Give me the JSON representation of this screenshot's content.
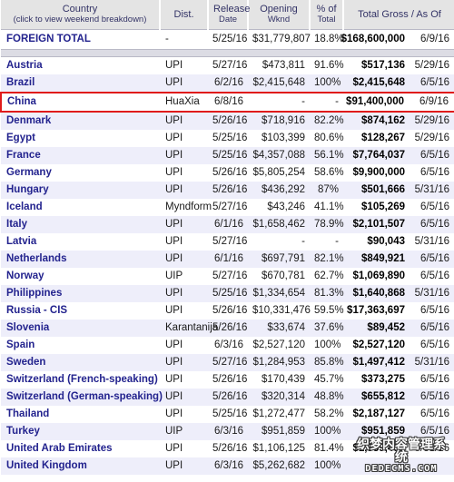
{
  "table": {
    "columns": [
      {
        "key": "country",
        "label": "Country",
        "sub": "(click to view weekend breakdown)"
      },
      {
        "key": "dist",
        "label": "Dist.",
        "sub": ""
      },
      {
        "key": "release",
        "label": "Release",
        "sub": "Date"
      },
      {
        "key": "opening",
        "label": "Opening",
        "sub": "Wknd"
      },
      {
        "key": "pct",
        "label": "% of",
        "sub": "Total"
      },
      {
        "key": "gross",
        "label": "Total Gross / As Of",
        "sub": ""
      }
    ],
    "total_row": {
      "country": "FOREIGN TOTAL",
      "dist": "-",
      "release": "5/25/16",
      "opening": "$31,779,807",
      "pct": "18.8%",
      "gross": "$168,600,000",
      "asof": "6/9/16"
    },
    "rows": [
      {
        "country": "Austria",
        "dist": "UPI",
        "release": "5/27/16",
        "opening": "$473,811",
        "pct": "91.6%",
        "gross": "$517,136",
        "asof": "5/29/16",
        "highlight": false
      },
      {
        "country": "Brazil",
        "dist": "UPI",
        "release": "6/2/16",
        "opening": "$2,415,648",
        "pct": "100%",
        "gross": "$2,415,648",
        "asof": "6/5/16",
        "highlight": false
      },
      {
        "country": "China",
        "dist": "HuaXia",
        "release": "6/8/16",
        "opening": "-",
        "pct": "-",
        "gross": "$91,400,000",
        "asof": "6/9/16",
        "highlight": true
      },
      {
        "country": "Denmark",
        "dist": "UPI",
        "release": "5/26/16",
        "opening": "$718,916",
        "pct": "82.2%",
        "gross": "$874,162",
        "asof": "5/29/16",
        "highlight": false
      },
      {
        "country": "Egypt",
        "dist": "UPI",
        "release": "5/25/16",
        "opening": "$103,399",
        "pct": "80.6%",
        "gross": "$128,267",
        "asof": "5/29/16",
        "highlight": false
      },
      {
        "country": "France",
        "dist": "UPI",
        "release": "5/25/16",
        "opening": "$4,357,088",
        "pct": "56.1%",
        "gross": "$7,764,037",
        "asof": "6/5/16",
        "highlight": false
      },
      {
        "country": "Germany",
        "dist": "UPI",
        "release": "5/26/16",
        "opening": "$5,805,254",
        "pct": "58.6%",
        "gross": "$9,900,000",
        "asof": "6/5/16",
        "highlight": false
      },
      {
        "country": "Hungary",
        "dist": "UPI",
        "release": "5/26/16",
        "opening": "$436,292",
        "pct": "87%",
        "gross": "$501,666",
        "asof": "5/31/16",
        "highlight": false
      },
      {
        "country": "Iceland",
        "dist": "Myndform",
        "release": "5/27/16",
        "opening": "$43,246",
        "pct": "41.1%",
        "gross": "$105,269",
        "asof": "6/5/16",
        "highlight": false
      },
      {
        "country": "Italy",
        "dist": "UPI",
        "release": "6/1/16",
        "opening": "$1,658,462",
        "pct": "78.9%",
        "gross": "$2,101,507",
        "asof": "6/5/16",
        "highlight": false
      },
      {
        "country": "Latvia",
        "dist": "UPI",
        "release": "5/27/16",
        "opening": "-",
        "pct": "-",
        "gross": "$90,043",
        "asof": "5/31/16",
        "highlight": false
      },
      {
        "country": "Netherlands",
        "dist": "UPI",
        "release": "6/1/16",
        "opening": "$697,791",
        "pct": "82.1%",
        "gross": "$849,921",
        "asof": "6/5/16",
        "highlight": false
      },
      {
        "country": "Norway",
        "dist": "UIP",
        "release": "5/27/16",
        "opening": "$670,781",
        "pct": "62.7%",
        "gross": "$1,069,890",
        "asof": "6/5/16",
        "highlight": false
      },
      {
        "country": "Philippines",
        "dist": "UPI",
        "release": "5/25/16",
        "opening": "$1,334,654",
        "pct": "81.3%",
        "gross": "$1,640,868",
        "asof": "5/31/16",
        "highlight": false
      },
      {
        "country": "Russia - CIS",
        "dist": "UPI",
        "release": "5/26/16",
        "opening": "$10,331,476",
        "pct": "59.5%",
        "gross": "$17,363,697",
        "asof": "6/5/16",
        "highlight": false
      },
      {
        "country": "Slovenia",
        "dist": "Karantanija",
        "release": "5/26/16",
        "opening": "$33,674",
        "pct": "37.6%",
        "gross": "$89,452",
        "asof": "6/5/16",
        "highlight": false
      },
      {
        "country": "Spain",
        "dist": "UPI",
        "release": "6/3/16",
        "opening": "$2,527,120",
        "pct": "100%",
        "gross": "$2,527,120",
        "asof": "6/5/16",
        "highlight": false
      },
      {
        "country": "Sweden",
        "dist": "UPI",
        "release": "5/27/16",
        "opening": "$1,284,953",
        "pct": "85.8%",
        "gross": "$1,497,412",
        "asof": "5/31/16",
        "highlight": false
      },
      {
        "country": "Switzerland (French-speaking)",
        "dist": "UPI",
        "release": "5/26/16",
        "opening": "$170,439",
        "pct": "45.7%",
        "gross": "$373,275",
        "asof": "6/5/16",
        "highlight": false
      },
      {
        "country": "Switzerland (German-speaking)",
        "dist": "UPI",
        "release": "5/26/16",
        "opening": "$320,314",
        "pct": "48.8%",
        "gross": "$655,812",
        "asof": "6/5/16",
        "highlight": false
      },
      {
        "country": "Thailand",
        "dist": "UPI",
        "release": "5/25/16",
        "opening": "$1,272,477",
        "pct": "58.2%",
        "gross": "$2,187,127",
        "asof": "6/5/16",
        "highlight": false
      },
      {
        "country": "Turkey",
        "dist": "UIP",
        "release": "6/3/16",
        "opening": "$951,859",
        "pct": "100%",
        "gross": "$951,859",
        "asof": "6/5/16",
        "highlight": false
      },
      {
        "country": "United Arab Emirates",
        "dist": "UPI",
        "release": "5/26/16",
        "opening": "$1,106,125",
        "pct": "81.4%",
        "gross": "$1,359,435",
        "asof": "5/31/16",
        "highlight": false
      },
      {
        "country": "United Kingdom",
        "dist": "UPI",
        "release": "6/3/16",
        "opening": "$5,262,682",
        "pct": "100%",
        "gross": "",
        "asof": "",
        "highlight": false
      }
    ]
  },
  "watermark": {
    "chinese": "织梦内容管理系统",
    "latin": "DEDECMS.COM"
  },
  "colors": {
    "header_bg": "#e4e4e4",
    "header_text": "#333366",
    "link_text": "#23238e",
    "row_alt_bg": "#eeeefa",
    "highlight_border": "#e01b1b",
    "spacer_bg": "#dcdce4"
  }
}
